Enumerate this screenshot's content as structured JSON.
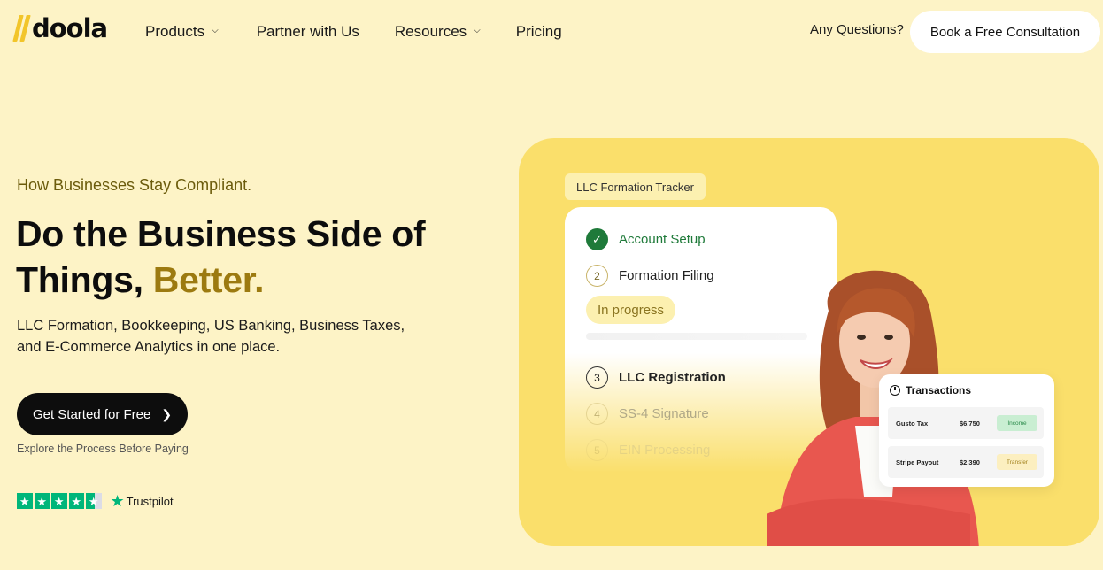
{
  "nav": {
    "logo_text": "doola",
    "brand_color": "#f2c52a",
    "links": [
      {
        "label": "Products",
        "has_dropdown": true
      },
      {
        "label": "Partner with Us",
        "has_dropdown": false
      },
      {
        "label": "Resources",
        "has_dropdown": true
      },
      {
        "label": "Pricing",
        "has_dropdown": false
      }
    ],
    "questions_label": "Any Questions?",
    "consult_button": "Book a Free Consultation"
  },
  "hero": {
    "eyebrow": "How Businesses Stay Compliant.",
    "headline_main": "Do the Business Side of Things, ",
    "headline_accent": "Better.",
    "subtext": "LLC Formation, Bookkeeping, US Banking, Business Taxes, and E-Commerce Analytics in one place.",
    "cta_label": "Get Started for Free",
    "cta_caption": "Explore the Process Before Paying",
    "trustpilot_label": "Trustpilot",
    "trustpilot_stars": 4.5
  },
  "tracker": {
    "tag": "LLC Formation Tracker",
    "steps": [
      {
        "number": "1",
        "label": "Account Setup",
        "status": "done"
      },
      {
        "number": "2",
        "label": "Formation Filing",
        "status": "current"
      },
      {
        "number": "3",
        "label": "LLC Registration",
        "status": "pending"
      },
      {
        "number": "4",
        "label": "SS-4 Signature",
        "status": "pending"
      },
      {
        "number": "5",
        "label": "EIN Processing",
        "status": "pending"
      }
    ],
    "progress_label": "In progress"
  },
  "transactions": {
    "title": "Transactions",
    "rows": [
      {
        "name": "Gusto Tax",
        "amount": "$6,750",
        "type": "Income"
      },
      {
        "name": "Stripe Payout",
        "amount": "$2,390",
        "type": "Transfer"
      }
    ]
  },
  "colors": {
    "page_bg": "#fdf3c6",
    "panel_bg": "#fadf6b",
    "accent_text": "#9c7a10",
    "success": "#1f7a3a",
    "trustpilot": "#00b67a"
  }
}
